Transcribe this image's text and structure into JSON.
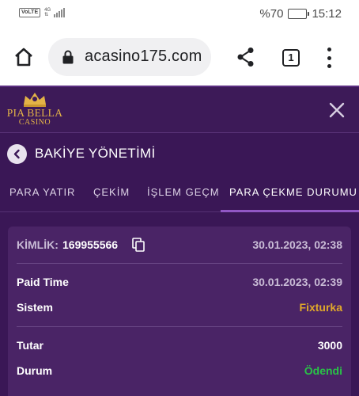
{
  "status_bar": {
    "volte": "VoLTE",
    "network": "4G",
    "battery_percent": "%70",
    "battery_level": 0.7,
    "time": "15:12"
  },
  "browser": {
    "url": "acasino175.com",
    "tab_count": "1",
    "icons": [
      "home-icon",
      "lock-icon",
      "share-icon",
      "tabs-icon",
      "more-vert-icon"
    ]
  },
  "site": {
    "brand_line1": "PIA BELLA",
    "brand_line2": "CASINO",
    "brand_color": "#e3b347",
    "icons": [
      "crown-icon",
      "close-icon"
    ]
  },
  "page": {
    "title": "BAKİYE YÖNETİMİ",
    "tabs": [
      {
        "label": "PARA YATIR"
      },
      {
        "label": "ÇEKİM"
      },
      {
        "label": "İŞLEM GEÇMİŞ"
      },
      {
        "label": "PARA ÇEKME DURUMU",
        "active": true
      }
    ]
  },
  "withdrawal": {
    "id_label": "KİMLİK:",
    "id_value": "169955566",
    "created_at": "30.01.2023, 02:38",
    "paid_time_label": "Paid Time",
    "paid_time_value": "30.01.2023, 02:39",
    "system_label": "Sistem",
    "system_value": "Fixturka",
    "amount_label": "Tutar",
    "amount_value": "3000",
    "status_label": "Durum",
    "status_value": "Ödendi"
  },
  "colors": {
    "background": "#3a1756",
    "card": "#4a2466",
    "accent": "#9157c4",
    "system_value": "#e0a82a",
    "status_paid": "#29c247"
  }
}
